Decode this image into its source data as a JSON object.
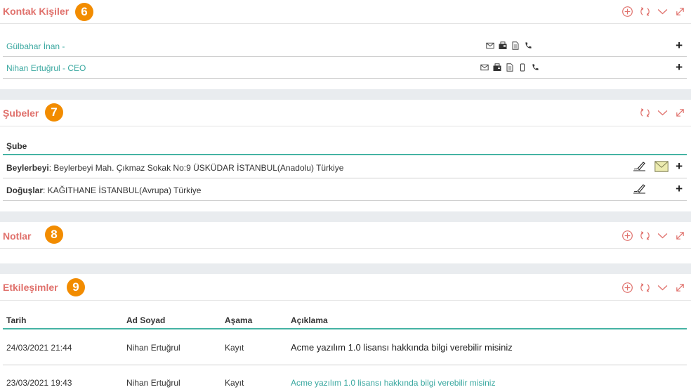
{
  "accent_color": "#e0716c",
  "badge_color": "#f28c00",
  "link_color": "#3aa8a0",
  "table_rule_color": "#45b3a3",
  "contacts_panel": {
    "title": "Kontak Kişiler",
    "badge": "6",
    "tools": [
      "plus-circle-icon",
      "refresh-icon",
      "chevron-down-icon",
      "expand-icon"
    ],
    "contacts": [
      {
        "name": "Gülbahar İnan -",
        "icons": [
          "mail-icon",
          "fax-icon",
          "document-icon",
          "phone-icon"
        ],
        "action": "+"
      },
      {
        "name": "Nihan Ertuğrul - CEO",
        "icons": [
          "mail-icon",
          "fax-icon",
          "document-icon",
          "mobile-icon",
          "phone-icon"
        ],
        "action": "+"
      }
    ]
  },
  "branches_panel": {
    "title": "Şubeler",
    "badge": "7",
    "tools": [
      "refresh-icon",
      "chevron-down-icon",
      "expand-icon"
    ],
    "column_header": "Şube",
    "rows": [
      {
        "name": "Beylerbeyi",
        "address": ": Beylerbeyi Mah. Çıkmaz Sokak No:9 ÜSKÜDAR İSTANBUL(Anadolu) Türkiye",
        "icons": [
          "signature-icon",
          "envelope-icon"
        ],
        "action": "+"
      },
      {
        "name": "Doğuşlar",
        "address": ": KAĞITHANE İSTANBUL(Avrupa) Türkiye",
        "icons": [
          "signature-icon"
        ],
        "action": "+"
      }
    ]
  },
  "notes_panel": {
    "title": "Notlar",
    "badge": "8",
    "tools": [
      "plus-circle-icon",
      "refresh-icon",
      "chevron-down-icon",
      "expand-icon"
    ]
  },
  "interactions_panel": {
    "title": "Etkileşimler",
    "badge": "9",
    "tools": [
      "plus-circle-icon",
      "refresh-icon",
      "chevron-down-icon",
      "expand-icon"
    ],
    "columns": [
      "Tarih",
      "Ad Soyad",
      "Aşama",
      "Açıklama"
    ],
    "rows": [
      {
        "date": "24/03/2021 21:44",
        "name": "Nihan Ertuğrul",
        "stage": "Kayıt",
        "description": "Acme yazılım 1.0 lisansı hakkında bilgi verebilir misiniz"
      },
      {
        "date": "23/03/2021 19:43",
        "name": "Nihan Ertuğrul",
        "stage": "Kayıt",
        "description": "Acme yazılım 1.0 lisansı hakkında bilgi verebilir misiniz"
      }
    ]
  }
}
